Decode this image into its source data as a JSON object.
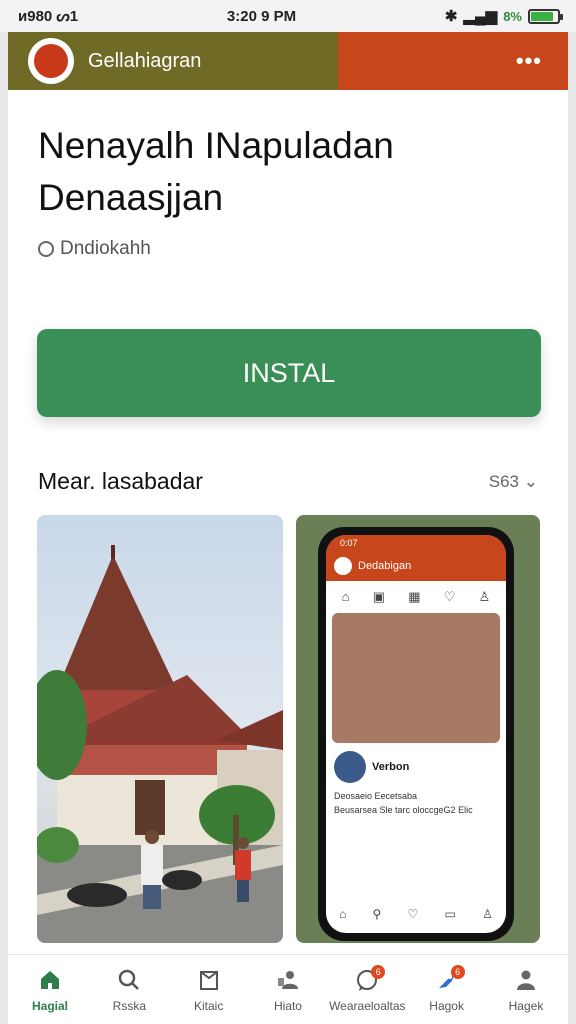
{
  "status_bar": {
    "left_text": "ᴎ980 ᔕ1",
    "time": "3:20 9 PM",
    "battery_pct": "8%",
    "battery_level": 0.85
  },
  "header": {
    "app_name": "Gellahiagran",
    "menu_dots": "•••"
  },
  "app": {
    "title": "Nenayalh INapuladan Denaasjjan",
    "developer": "Dndiokahh",
    "install_label": "INSTAL"
  },
  "screenshots": {
    "section_title": "Mear. lasabadar",
    "see_more": "S63",
    "phone_mock": {
      "time": "0:07",
      "app_name": "Dedabigan",
      "user_name": "Verbon",
      "line1": "Deosaeio Eecetsaba",
      "line2": "Beusarsea Sle tarc oloccgeG2 Elic"
    }
  },
  "bottom_nav": {
    "items": [
      {
        "label": "Hagial",
        "icon": "home-icon",
        "active": true
      },
      {
        "label": "Rsska",
        "icon": "search-icon"
      },
      {
        "label": "Kitaic",
        "icon": "book-icon"
      },
      {
        "label": "Hiato",
        "icon": "people-icon"
      },
      {
        "label": "Wearaeloaltas",
        "icon": "chat-icon",
        "badge": "6"
      },
      {
        "label": "Hagok",
        "icon": "rocket-icon",
        "badge": "6"
      },
      {
        "label": "Hagek",
        "icon": "person-icon"
      }
    ]
  },
  "colors": {
    "header_olive": "#6f6a26",
    "header_orange": "#c8461c",
    "install_green": "#3a8f57",
    "active_nav": "#2e7d4a"
  }
}
